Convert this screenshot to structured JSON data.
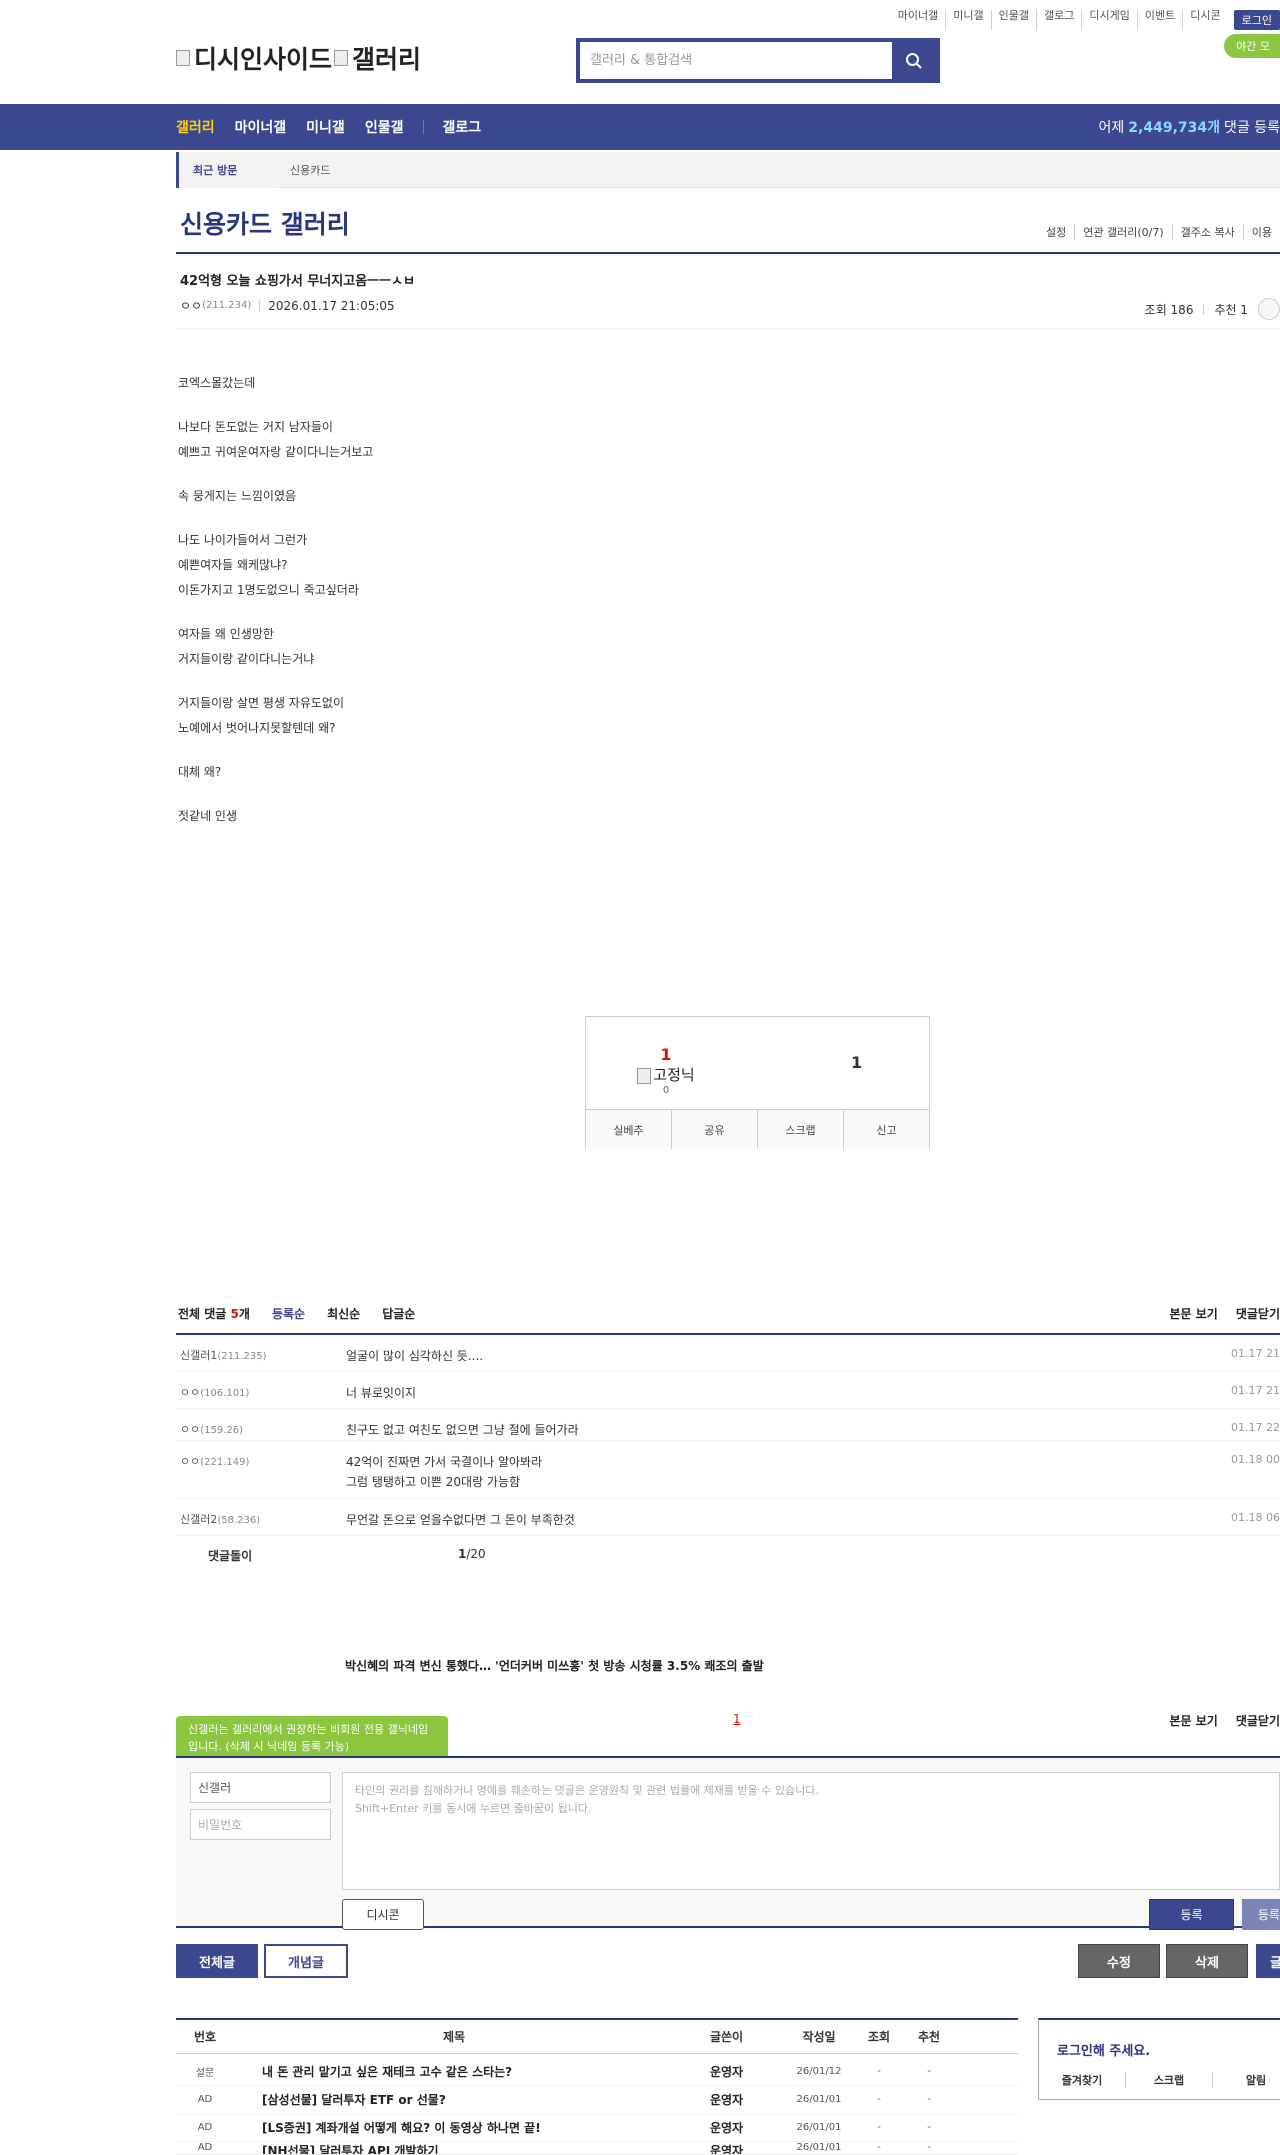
{
  "header": {
    "top_links": [
      "마이너갤",
      "미니갤",
      "인물갤",
      "갤로그",
      "디시게임",
      "이벤트",
      "디시콘"
    ],
    "login_label": "로그인",
    "night_mode_label": "야간 모",
    "logo_text": "디시인사이드",
    "logo_sub": "갤러리",
    "search_placeholder": "갤러리 & 통합검색"
  },
  "nav": {
    "items": [
      "갤러리",
      "마이너갤",
      "미니갤",
      "인물갤",
      "갤로그"
    ],
    "stats_prefix": "어제",
    "stats_number": "2,449,734개",
    "stats_suffix": "댓글 등록"
  },
  "recent": {
    "label": "최근 방문",
    "item": "신용카드"
  },
  "gallery": {
    "title": "신용카드 갤러리",
    "menu": [
      "설정",
      "연관 갤러리(0/7)",
      "갤주소 복사",
      "이용"
    ]
  },
  "post": {
    "title": "42억형 오늘 쇼핑가서 무너지고옴ㅡㅡㅅㅂ",
    "author": "ㅇㅇ",
    "author_ip": "(211.234)",
    "datetime": "2026.01.17 21:05:05",
    "views": "조회 186",
    "recommend": "추천 1",
    "body": [
      "코엑스몰갔는데",
      "",
      "나보다 돈도없는 거지 남자들이",
      "예쁘고 귀여운여자랑 같이다니는거보고",
      "",
      "속 뭉게지는 느낌이였음",
      "",
      "나도 나이가들어서 그런가",
      "예쁜여자들 왜케많냐?",
      "이돈가지고 1명도없으니 죽고싶더라",
      "",
      "여자들 왜 인생망한",
      "거지들이랑 같이다니는거냐",
      "",
      "거지들이랑 살면 평생 자유도없이",
      "노예에서 벗어나지못할텐데 왜?",
      "",
      "대체 왜?",
      "",
      "젓같네 인생"
    ]
  },
  "recommend_box": {
    "up_count": "1",
    "fixed_label": "고정닉",
    "fixed_count": "0",
    "down_count": "1",
    "buttons": [
      "실베추",
      "공유",
      "스크랩",
      "신고"
    ]
  },
  "comments": {
    "head_label": "전체 댓글",
    "count": "5",
    "count_unit": "개",
    "sorts": [
      "등록순",
      "최신순",
      "답글순"
    ],
    "right_links": [
      "본문 보기",
      "댓글닫기"
    ],
    "items": [
      {
        "nick": "신갤러1",
        "ip": "(211.235)",
        "text": [
          "얼굴이 많이 심각하신 듯...."
        ],
        "date": "01.17 21"
      },
      {
        "nick": "ㅇㅇ",
        "ip": "(106.101)",
        "text": [
          "너 뷰로잇이지"
        ],
        "date": "01.17 21"
      },
      {
        "nick": "ㅇㅇ",
        "ip": "(159.26)",
        "text": [
          "친구도 없고 여친도 없으면 그냥 절에 들어가라"
        ],
        "date": "01.17 22"
      },
      {
        "nick": "ㅇㅇ",
        "ip": "(221.149)",
        "text": [
          "42억이 진짜면 가서 국결이나 알아봐라",
          "그럼 탱탱하고 이쁜 20대랑 가능함"
        ],
        "date": "01.18 00"
      },
      {
        "nick": "신갤러2",
        "ip": "(58.236)",
        "text": [
          "무언갈 돈으로 얻을수없다면 그 돈이 부족한것"
        ],
        "date": "01.18 06"
      }
    ],
    "pager_label": "댓글돌이",
    "pager_current": "1",
    "pager_total": "/20"
  },
  "promo_text": "박신혜의 파격 변신 통했다… '언더커버 미쓰홍' 첫 방송 시청률 3.5% 쾌조의 출발",
  "write": {
    "tip": "신갤러는 갤러리에서 권장하는 비회원 전용 갤닉네임입니다. (삭제 시 닉네임 등록 가능)",
    "page_link": "1",
    "right_links": [
      "본문 보기",
      "댓글닫기"
    ],
    "nick_value": "신갤러",
    "password_placeholder": "비밀번호",
    "textarea_line1": "타인의 권리를 침해하거나 명예를 훼손하는 댓글은 운영원칙 및 관련 법률에 제재를 받을 수 있습니다.",
    "textarea_line2": "Shift+Enter 키를 동시에 누르면 줄바꿈이 됩니다.",
    "dccon_label": "디시콘",
    "submit_label": "등록",
    "submit2_label": "등록"
  },
  "board_buttons": {
    "all": "전체글",
    "concept": "개념글",
    "edit": "수정",
    "delete": "삭제",
    "write": "글"
  },
  "list": {
    "headers": [
      "번호",
      "제목",
      "글쓴이",
      "작성일",
      "조회",
      "추천"
    ],
    "rows": [
      {
        "num": "설문",
        "title": "내 돈 관리 맡기고 싶은 재테크 고수 같은 스타는?",
        "writer": "운영자",
        "date": "26/01/12",
        "views": "-",
        "rec": "-"
      },
      {
        "num": "AD",
        "title": "[삼성선물] 달러투자 ETF or 선물?",
        "writer": "운영자",
        "date": "26/01/01",
        "views": "-",
        "rec": "-"
      },
      {
        "num": "AD",
        "title": "[LS증권] 계좌개설 어떻게 해요? 이 동영상 하나면 끝!",
        "writer": "운영자",
        "date": "26/01/01",
        "views": "-",
        "rec": "-"
      },
      {
        "num": "AD",
        "title": "[NH선물] 달러투자 API 개발하기",
        "writer": "운영자",
        "date": "26/01/01",
        "views": "-",
        "rec": "-"
      }
    ]
  },
  "login_box": {
    "title": "로그인해 주세요.",
    "links": [
      "즐겨찾기",
      "스크랩",
      "알림"
    ]
  }
}
